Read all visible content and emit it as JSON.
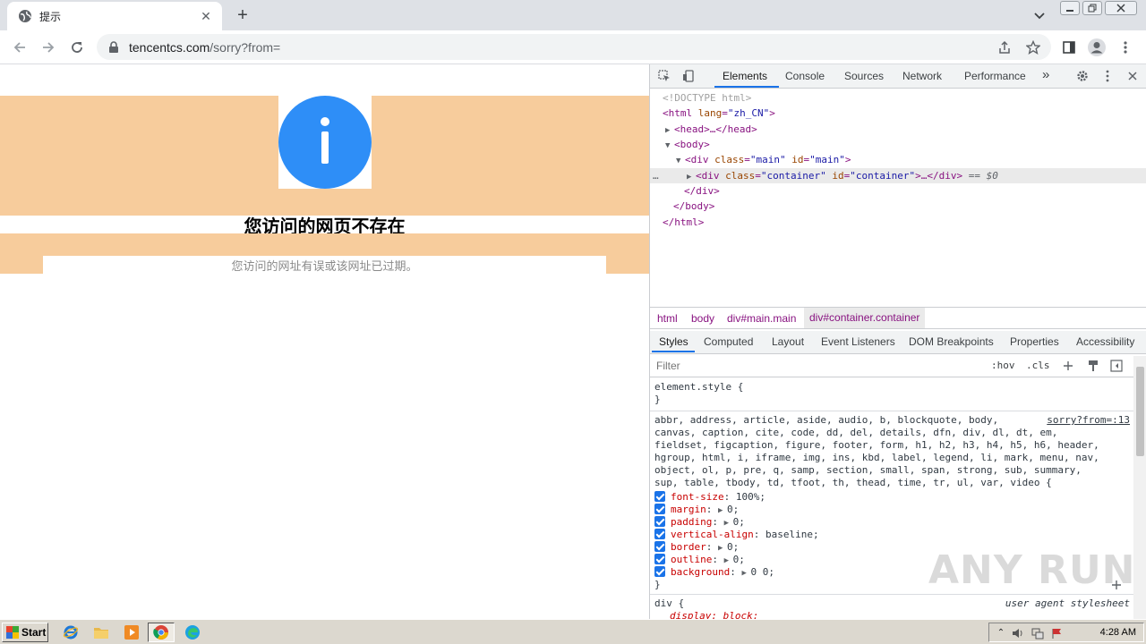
{
  "browser": {
    "tab_title": "提示",
    "new_tab_symbol": "+",
    "url_host": "tencentcs.com",
    "url_path": "/sorry?from="
  },
  "page": {
    "heading": "您访问的网页不存在",
    "message": "您访问的网址有误或该网址已过期。"
  },
  "devtools": {
    "tabs": [
      "Elements",
      "Console",
      "Sources",
      "Network",
      "Performance"
    ],
    "more_tabs_symbol": "»",
    "dom": {
      "doctype": "<!DOCTYPE html>",
      "html_open_tag": "<html",
      "html_lang_attr": "lang",
      "html_lang_val": "\"zh_CN\"",
      "head_collapsed": "<head>…</head>",
      "body_open": "<body>",
      "div_main_tag": "<div",
      "attr_class": "class",
      "div_main_class": "\"main\"",
      "attr_id": "id",
      "div_main_id": "\"main\"",
      "div_container_class": "\"container\"",
      "div_container_id": "\"container\"",
      "collapsed_close": ">…</div>",
      "selected_marker": "== $0",
      "ellipsis": "…",
      "div_close": "</div>",
      "body_close": "</body>",
      "html_close": "</html>"
    },
    "breadcrumbs": {
      "html": "html",
      "body": "body",
      "main": "div#main.main",
      "container": "div#container.container"
    },
    "subtabs": [
      "Styles",
      "Computed",
      "Layout",
      "Event Listeners",
      "DOM Breakpoints",
      "Properties",
      "Accessibility"
    ],
    "filter_placeholder": "Filter",
    "filter_hov": ":hov",
    "filter_cls": ".cls",
    "styles": {
      "element_style": "element.style {",
      "close_brace": "}",
      "reset_selectors": [
        "abbr, address, article, aside, audio, b, blockquote, body,",
        "canvas, caption, cite, code, dd, del, details, dfn, div, dl, dt, em,",
        "fieldset, figcaption, figure, footer, form, h1, h2, h3, h4, h5, h6, header,",
        "hgroup, html, i, iframe, img, ins, kbd, label, legend, li, mark, menu, nav,",
        "object, ol, p, pre, q, samp, section, small, span, strong, sub, summary,",
        "sup, table, tbody, td, tfoot, th, thead, time, tr, ul, var, video {"
      ],
      "reset_source": "sorry?from=:13",
      "declarations": [
        {
          "prop": "font-size",
          "value": "100%;",
          "expand": false
        },
        {
          "prop": "margin",
          "value": "0;",
          "expand": true
        },
        {
          "prop": "padding",
          "value": "0;",
          "expand": true
        },
        {
          "prop": "vertical-align",
          "value": "baseline;",
          "expand": false
        },
        {
          "prop": "border",
          "value": "0;",
          "expand": true
        },
        {
          "prop": "outline",
          "value": "0;",
          "expand": true
        },
        {
          "prop": "background",
          "value": "0 0;",
          "expand": true
        }
      ],
      "div_selector": "div {",
      "ua_source": "user agent stylesheet",
      "display_decl": "display: block;"
    }
  },
  "watermark": "ANY RUN",
  "taskbar": {
    "start_label": "Start",
    "clock": "4:28 AM"
  },
  "colors": {
    "peach": "#f7cc9c",
    "info_blue": "#2e8ef7",
    "devtools_accent": "#1a73e8"
  }
}
